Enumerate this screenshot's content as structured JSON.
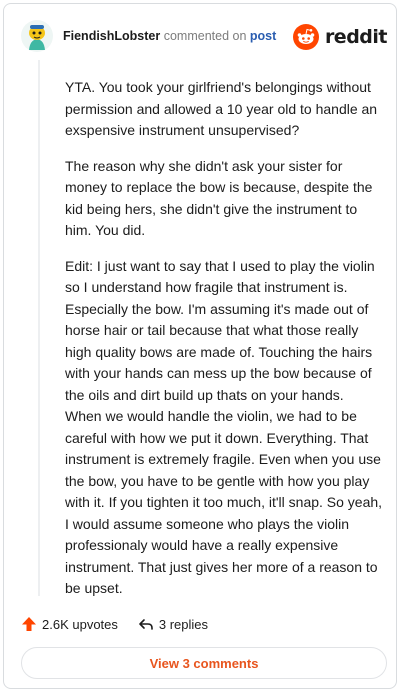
{
  "comment": {
    "author": "FiendishLobster",
    "action_text": "commented on",
    "target_text": "post",
    "paragraphs": [
      "YTA. You took your girlfriend's belongings without permission and allowed a 10 year old to handle an exspensive instrument unsupervised?",
      "The reason why she didn't ask your sister for money to replace the bow is because, despite the kid being hers, she didn't give the instrument to him. You did.",
      "Edit: I just want to say that I used to play the violin so I understand how fragile that instrument is. Especially the bow. I'm assuming it's made out of horse hair or tail because that what those really high quality bows are made of. Touching the hairs with your hands can mess up the bow because of the oils and dirt build up thats on your hands. When we would handle the violin, we had to be careful with how we put it down. Everything. That instrument is extremely fragile. Even when you use the bow, you have to be gentle with how you play with it. If you tighten it too much, it'll snap. So yeah, I would assume someone who plays the violin professionaly would have a really expensive instrument. That just gives her more of a reason to be upset."
    ],
    "upvotes_text": "2.6K upvotes",
    "replies_text": "3 replies"
  },
  "brand": {
    "name": "reddit",
    "icon": "reddit-snoo-icon",
    "color": "#ff4500"
  },
  "icons": {
    "avatar": "avatar-image",
    "upvote": "upvote-arrow-icon",
    "reply": "reply-arrow-icon"
  },
  "colors": {
    "upvote": "#ff4500",
    "link": "#2a5db0",
    "view_button_text": "#e8551e"
  },
  "footer": {
    "view_comments_label": "View 3 comments"
  }
}
